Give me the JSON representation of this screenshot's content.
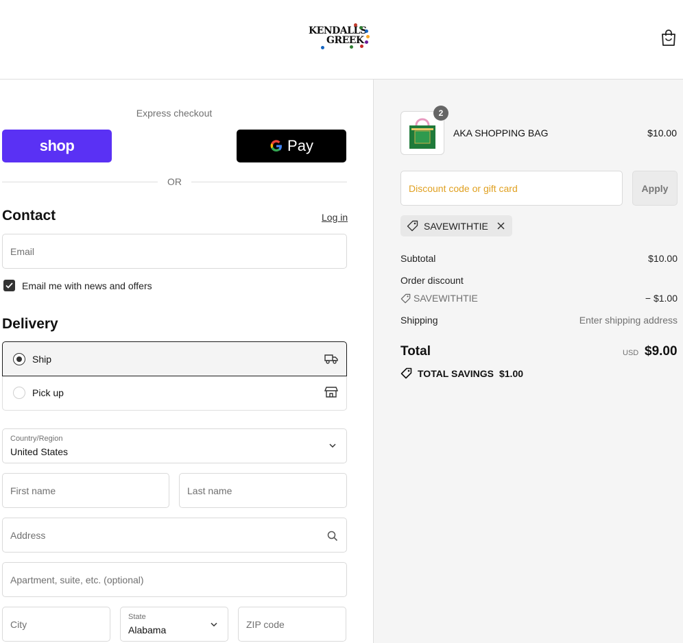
{
  "header": {
    "logo_line1": "KENDALLS",
    "logo_line2": "GREEK",
    "cart_icon": "shopping-bag-icon"
  },
  "express": {
    "label": "Express checkout",
    "shop_label": "shop",
    "gpay_g": "G",
    "gpay_label": "Pay",
    "or": "OR"
  },
  "contact": {
    "title": "Contact",
    "login": "Log in",
    "email_placeholder": "Email",
    "newsletter_label": "Email me with news and offers",
    "newsletter_checked": true
  },
  "delivery": {
    "title": "Delivery",
    "options": [
      {
        "label": "Ship",
        "selected": true,
        "icon": "truck-icon"
      },
      {
        "label": "Pick up",
        "selected": false,
        "icon": "store-icon"
      }
    ],
    "country_label": "Country/Region",
    "country_value": "United States",
    "first_name": "First name",
    "last_name": "Last name",
    "address": "Address",
    "apartment": "Apartment, suite, etc. (optional)",
    "city": "City",
    "state_label": "State",
    "state_value": "Alabama",
    "zip": "ZIP code"
  },
  "order": {
    "item_name": "AKA SHOPPING BAG",
    "item_price": "$10.00",
    "item_qty": "2",
    "discount_placeholder": "Discount code or gift card",
    "apply": "Apply",
    "code": "SAVEWITHTIE",
    "subtotal_label": "Subtotal",
    "subtotal_value": "$10.00",
    "order_discount_label": "Order discount",
    "discount_code": "SAVEWITHTIE",
    "discount_value": "− $1.00",
    "shipping_label": "Shipping",
    "shipping_value": "Enter shipping address",
    "total_label": "Total",
    "currency": "USD",
    "total_value": "$9.00",
    "savings_label": "TOTAL SAVINGS",
    "savings_value": "$1.00"
  },
  "colors": {
    "shop_purple": "#5a31f4",
    "discount_placeholder": "#e0a020",
    "summary_bg": "#f5f5f5"
  }
}
